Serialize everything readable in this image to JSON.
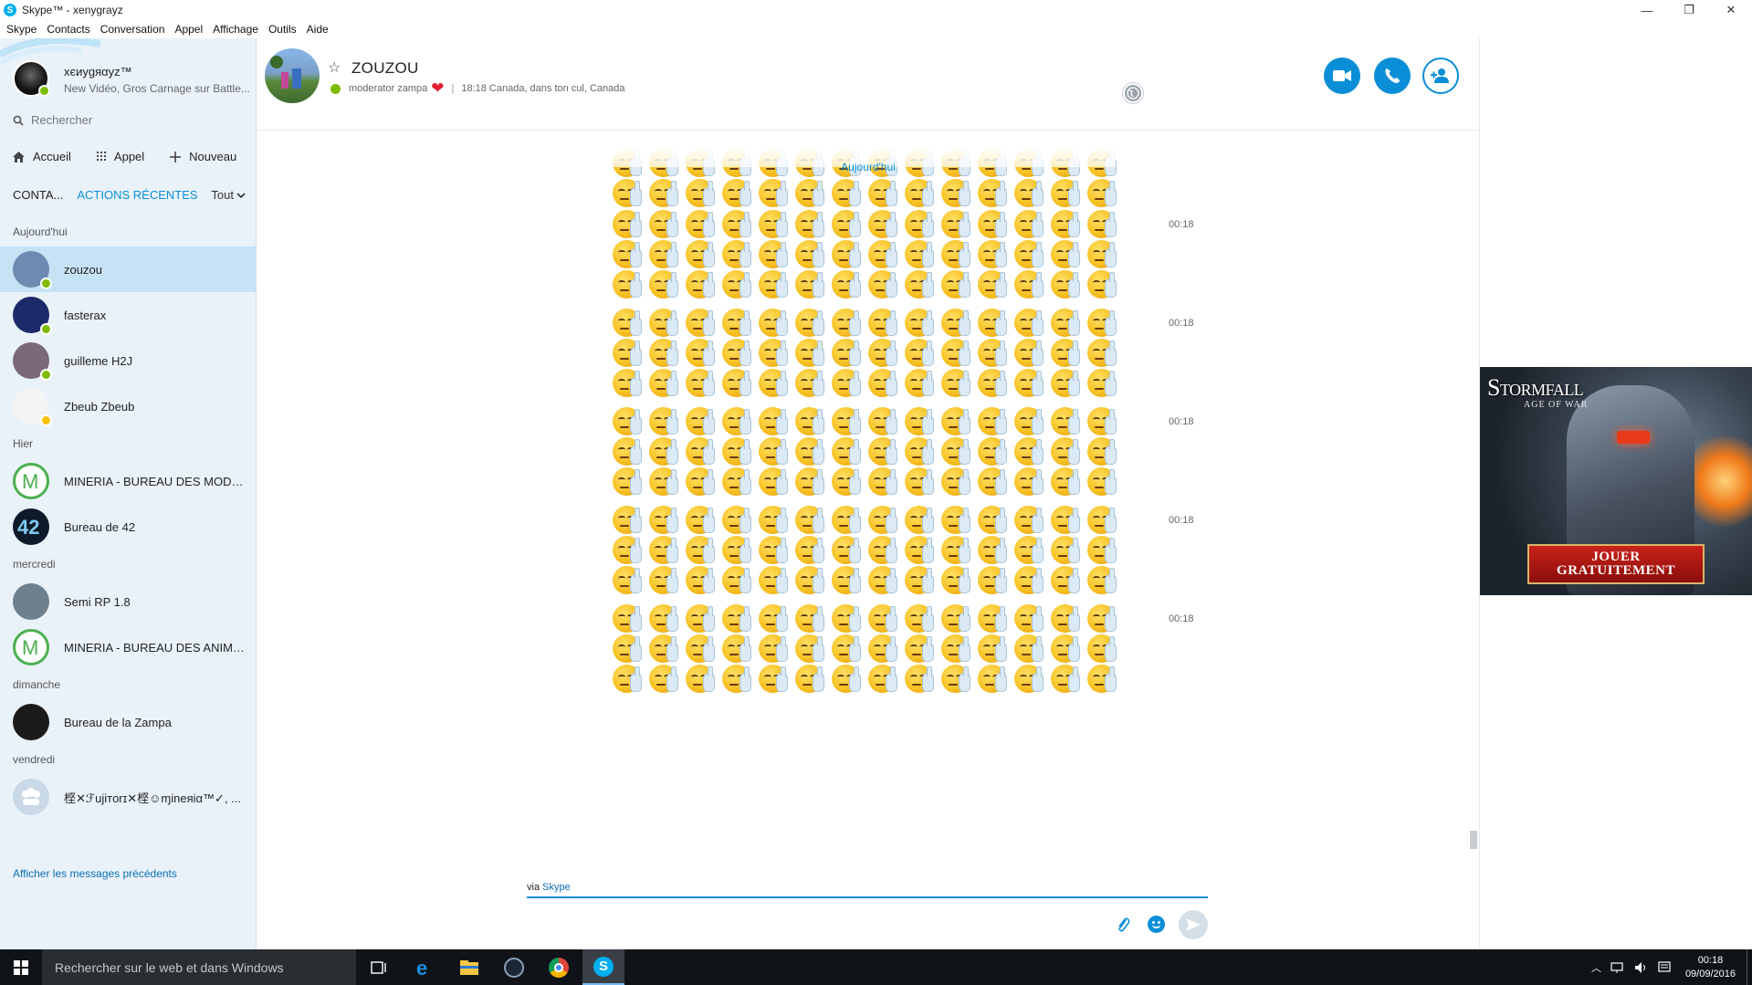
{
  "window": {
    "title": "Skype™ - xenygrayz",
    "app_icon": "S",
    "minimize": "—",
    "maximize": "❐",
    "close": "✕"
  },
  "menu": [
    "Skype",
    "Contacts",
    "Conversation",
    "Appel",
    "Affichage",
    "Outils",
    "Aide"
  ],
  "me": {
    "name": "xєиуgяαуz™",
    "mood": "New Vidéo, Gros Carnage sur Battle..."
  },
  "search": {
    "placeholder": "Rechercher"
  },
  "nav": {
    "home": "Accueil",
    "call": "Appel",
    "new": "Nouveau"
  },
  "tabs": {
    "contacts": "CONTA...",
    "recent": "ACTIONS RÉCENTES",
    "filter": "Tout"
  },
  "groups": [
    {
      "label": "Aujourd'hui",
      "items": [
        {
          "name": "zouzou",
          "status": "online",
          "active": true,
          "color": "#6f8ab0"
        },
        {
          "name": "fasterax",
          "status": "online",
          "color": "#1c2a6a"
        },
        {
          "name": "guilleme H2J",
          "status": "online",
          "color": "#7a6a78"
        },
        {
          "name": "Zbeub Zbeub",
          "status": "away",
          "color": "#f4f4f4"
        }
      ]
    },
    {
      "label": "Hier",
      "items": [
        {
          "name": "MINERIA - BUREAU DES MODOS",
          "status": "",
          "color": "#ffffff"
        },
        {
          "name": "Bureau de 42",
          "status": "",
          "color": "#0d1a2a"
        }
      ]
    },
    {
      "label": "mercredi",
      "items": [
        {
          "name": "Semi RP 1.8",
          "status": "",
          "color": "#6e7f8d"
        },
        {
          "name": "MINERIA - BUREAU DES ANIMA...",
          "status": "",
          "color": "#ffffff"
        }
      ]
    },
    {
      "label": "dimanche",
      "items": [
        {
          "name": "Bureau de la Zampa",
          "status": "",
          "color": "#1b1b1b"
        }
      ]
    },
    {
      "label": "vendredi",
      "items": [
        {
          "name": "㭴✕ℱujiтorɪ✕㭴☺ɱineяiα™✓, ...",
          "status": "",
          "color": "#c9d9e8"
        }
      ]
    }
  ],
  "more_messages": "Afficher les messages précédents",
  "conversation": {
    "name": "ZOUZOU",
    "mood": "moderator zampa",
    "heart": "❤",
    "location": "18:18 Canada, dans ton cul, Canada",
    "separator": "|"
  },
  "chat": {
    "day_label": "Aujourd'hui",
    "emoji_per_row": 14,
    "emoji_name": "middle-finger-emoticon",
    "messages": [
      {
        "time": "00:18",
        "rows": 2,
        "time_visible": false
      },
      {
        "time": "00:18",
        "rows": 3,
        "time_visible": true
      },
      {
        "time": "00:18",
        "rows": 3,
        "time_visible": true
      },
      {
        "time": "00:18",
        "rows": 3,
        "time_visible": true
      },
      {
        "time": "00:18",
        "rows": 3,
        "time_visible": true
      },
      {
        "time": "00:18",
        "rows": 3,
        "time_visible": true
      }
    ]
  },
  "composer": {
    "prefix": "via",
    "link": "Skype"
  },
  "ad": {
    "logo": "Stormfall",
    "tagline": "AGE OF WAR",
    "cta_line1": "JOUER",
    "cta_line2": "GRATUITEMENT"
  },
  "taskbar": {
    "search_placeholder": "Rechercher sur le web et dans Windows",
    "time": "00:18",
    "date": "09/09/2016"
  },
  "colors": {
    "accent": "#0a8ed8",
    "online": "#7cbb00",
    "away": "#f8c200",
    "sidebar_bg": "#eaf2f9",
    "selected": "#c6e3f6"
  }
}
